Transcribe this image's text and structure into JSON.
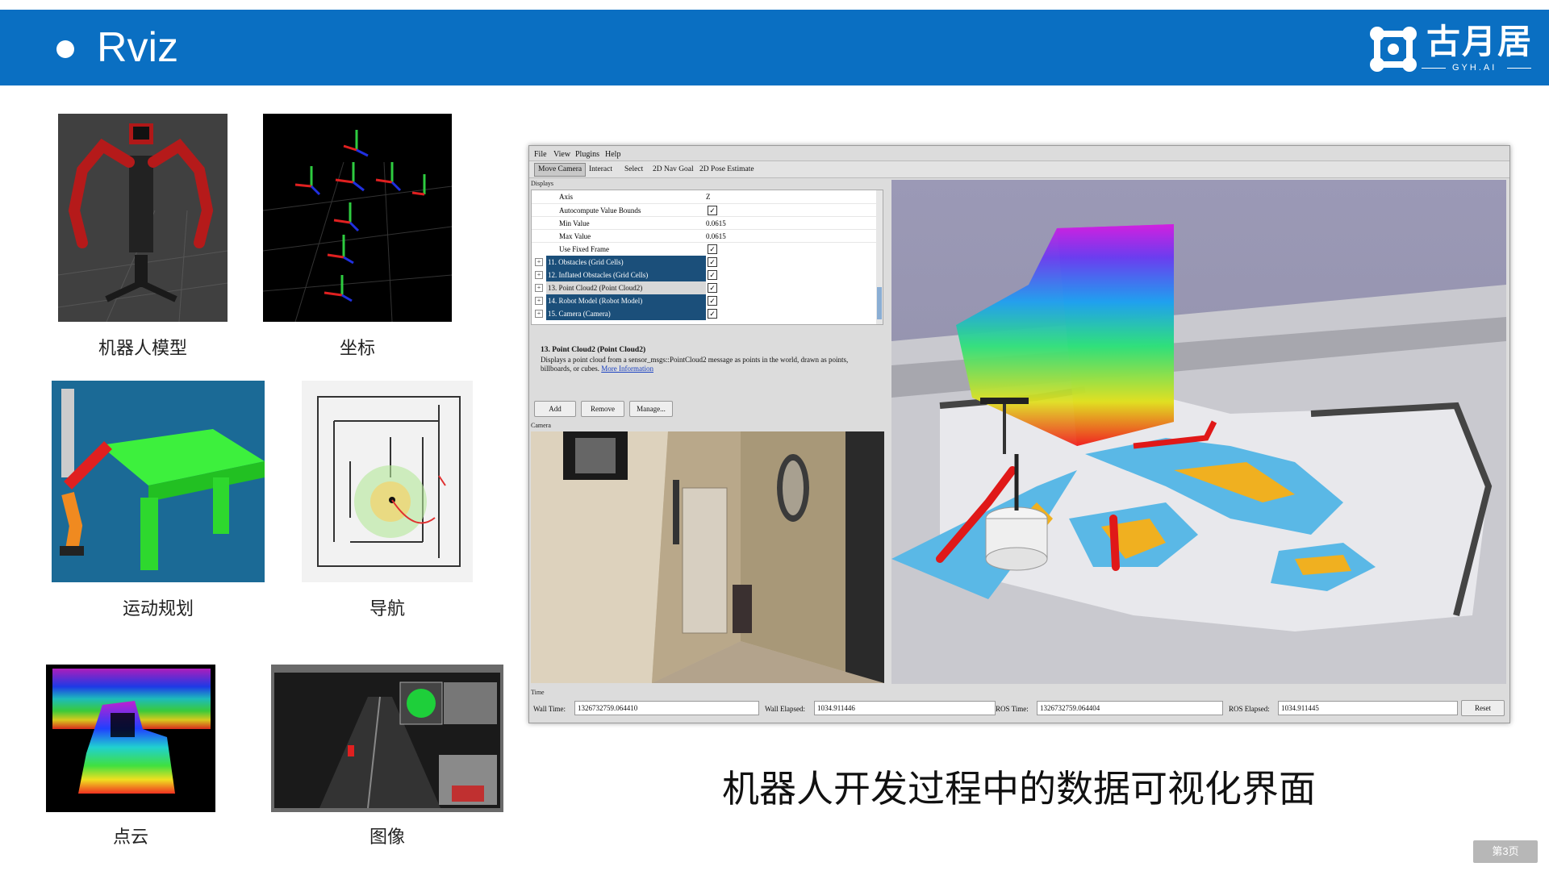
{
  "header": {
    "title": "Rviz",
    "logo_text": "古月居",
    "logo_subtext": "GYH.AI"
  },
  "thumbnails": [
    {
      "caption": "机器人模型"
    },
    {
      "caption": "坐标"
    },
    {
      "caption": "运动规划"
    },
    {
      "caption": "导航"
    },
    {
      "caption": "点云"
    },
    {
      "caption": "图像"
    }
  ],
  "rviz": {
    "menu": [
      "File",
      "View",
      "Plugins",
      "Help"
    ],
    "toolbar": [
      "Move Camera",
      "Interact",
      "Select",
      "2D Nav Goal",
      "2D Pose Estimate"
    ],
    "displays_title": "Displays",
    "properties": [
      {
        "label": "Axis",
        "value": "Z"
      },
      {
        "label": "Autocompute Value Bounds",
        "value": "✓"
      },
      {
        "label": "Min Value",
        "value": "0.0615"
      },
      {
        "label": "Max Value",
        "value": "0.0615"
      },
      {
        "label": "Use Fixed Frame",
        "value": "✓"
      }
    ],
    "display_items": [
      {
        "label": "11. Obstacles (Grid Cells)",
        "checked": "✓"
      },
      {
        "label": "12. Inflated Obstacles (Grid Cells)",
        "checked": "✓"
      },
      {
        "label": "13. Point Cloud2 (Point Cloud2)",
        "checked": "✓"
      },
      {
        "label": "14. Robot Model (Robot Model)",
        "checked": "✓"
      },
      {
        "label": "15. Camera (Camera)",
        "checked": "✓"
      }
    ],
    "description_title": "13. Point Cloud2 (Point Cloud2)",
    "description_text": "Displays a point cloud from a sensor_msgs::PointCloud2 message as points in the world, drawn as points, billboards, or cubes.",
    "description_link": "More Information",
    "buttons": {
      "add": "Add",
      "remove": "Remove",
      "manage": "Manage..."
    },
    "camera_title": "Camera",
    "time_title": "Time",
    "time": {
      "wall_time_label": "Wall Time:",
      "wall_time": "1326732759.064410",
      "wall_elapsed_label": "Wall Elapsed:",
      "wall_elapsed": "1034.911446",
      "ros_time_label": "ROS Time:",
      "ros_time": "1326732759.064404",
      "ros_elapsed_label": "ROS Elapsed:",
      "ros_elapsed": "1034.911445",
      "reset_label": "Reset"
    }
  },
  "subtitle": "机器人开发过程中的数据可视化界面",
  "page_number": "第3页",
  "colors": {
    "header_blue": "#0a6fc2",
    "selected_row": "#1b4f7a"
  }
}
